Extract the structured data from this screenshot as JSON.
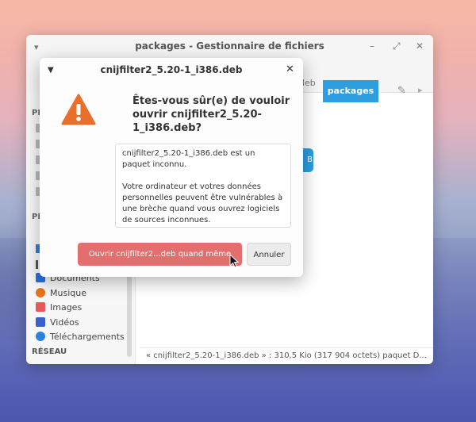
{
  "file_manager": {
    "title": "packages - Gestionnaire de fichiers",
    "breadcrumb_partial": "deb",
    "breadcrumb_current": "packages",
    "file_partial_label": "B",
    "sidebar": {
      "section_places_partial": "PL",
      "section_devices_partial": "ES",
      "items": [
        {
          "label": "Documents",
          "icon": "documents-icon",
          "color": "#2d6fd6"
        },
        {
          "label": "Musique",
          "icon": "music-icon",
          "color": "#e8731b"
        },
        {
          "label": "Images",
          "icon": "images-icon",
          "color": "#e85a5a"
        },
        {
          "label": "Vidéos",
          "icon": "video-icon",
          "color": "#3a62c8"
        },
        {
          "label": "Téléchargements",
          "icon": "download-icon",
          "color": "#2d7fe0"
        }
      ],
      "section_network": "RÉSEAU"
    },
    "statusbar": "« cnijfilter2_5.20-1_i386.deb » : 310,5 Kio (317 904 octets) paquet D..."
  },
  "dialog": {
    "title": "cnijfilter2_5.20-1_i386.deb",
    "question": "Êtes-vous sûr(e) de vouloir ouvrir cnijfilter2_5.20-1_i386.deb?",
    "message": [
      "cnijfilter2_5.20-1_i386.deb est un paquet inconnu.",
      "Votre ordinateur et votres données personnelles peuvent être vulnérables à une brèche quand vous ouvrez logiciels de sources inconnues."
    ],
    "open_button": "Ouvrir cnijfilter2...deb quand même",
    "cancel_button": "Annuler"
  },
  "colors": {
    "accent": "#2d9ee0",
    "warning": "#e8702b",
    "destructive": "#e36e6e"
  }
}
